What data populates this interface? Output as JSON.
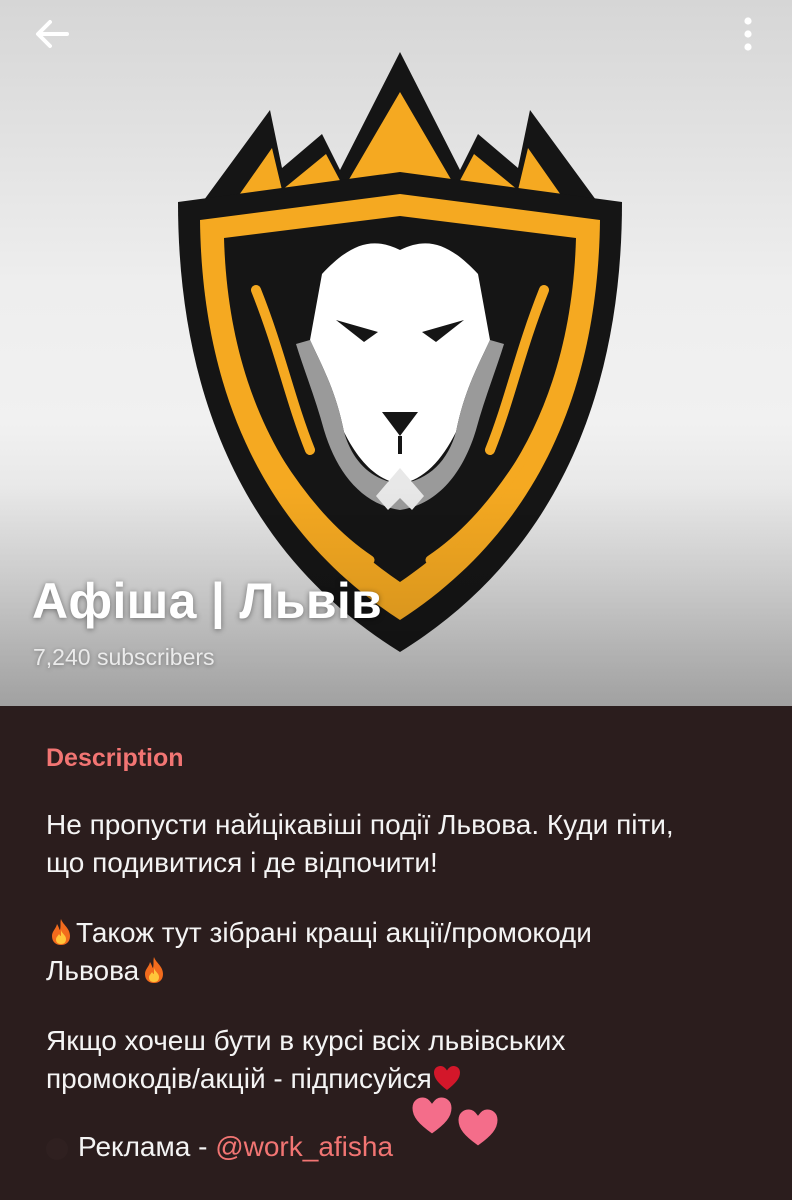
{
  "header": {
    "title": "Афіша | Львів",
    "subscribers": "7,240 subscribers"
  },
  "description": {
    "label": "Description",
    "line1": "Не пропусти найцікавіші події Львова. Куди піти,",
    "line2": "що подивитися і де відпочити!",
    "line3": "Також тут зібрані кращі акції/промокоди",
    "line4": "Львова",
    "line5": "Якщо хочеш бути в курсі всіх львівських",
    "line6": "промокодів/акцій - підписуйся",
    "ad_prefix": "Реклама - ",
    "ad_link": "@work_afisha"
  },
  "icons": {
    "back": "arrow-left-icon",
    "menu": "more-vertical-icon",
    "fire": "fire-emoji-icon",
    "heart": "red-heart-emoji-icon",
    "hearts": "two-hearts-emoji-icon",
    "logo": "lion-crown-shield-logo"
  },
  "colors": {
    "accent": "#f27573",
    "background": "#2b1d1d",
    "logo_gold": "#f5a921"
  }
}
